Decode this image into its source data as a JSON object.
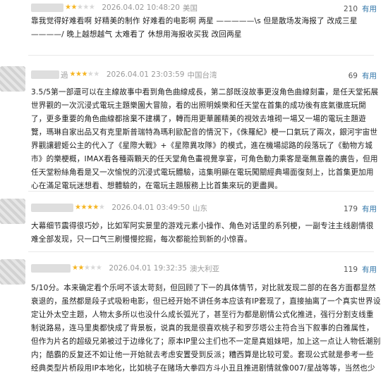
{
  "reviews": [
    {
      "rating": 2,
      "date": "2026.04.02 10:48:20",
      "location": "美国",
      "useful_count": "210",
      "useful_label": "有用",
      "lines": [
        "靠我觉得好难看啊 好精美的制作 好难看的电影啊 两星 —————\\s 但是散场发海报了 改成三星 ————/ 晚上越想越气 太难看了 休想用海报收买我 改回两星"
      ]
    },
    {
      "rating": 3,
      "user_suffix": "過",
      "date": "2026.04.01 23:03:59",
      "location": "中国台湾",
      "useful_count": "69",
      "useful_label": "有用",
      "lines": [
        "3.5/5第一部還可以在主線故事中看到角色曲線成長，第二部既沒故事更沒角色曲線刻畫，是任天堂拓展世界觀的一次沉浸式電玩主題樂園大冒險，看的出照明娛樂和任天堂在首集的成功後有底氣徹底玩開了，更多重要的角色曲線都捨棄不建構了，轉而用更華麗精美的視效去堆砌一場又一場的電玩主題遊覽，瑪琳自家出品又有克里斯普瑞特為瑪利歐配音的情況下，《侏羅紀》梗一口氣玩了兩次，銀河宇宙世界觀讓碧姬公主的代入了《星際大戰》+《星際異攻隊》的模式，進在機場認路的段落玩了《動物方城市》的樂梗概，IMAX看各種兩顆天的任天堂角色畫視覺享宴，可角色動力乘客是毫無意義的廣告，但用任天堂粉絲角看是又一次愉悅的沉浸式電玩體驗，這集明顯在電玩闖關經典場面復刻上，比首集更加用心在滿足電玩迷想看、想體驗的，在電玩主題服務上比首集來玩的更盡興。"
      ]
    },
    {
      "rating": 4,
      "date": "2026.04.01 03:49:50",
      "location": "山东",
      "useful_count": "179",
      "useful_label": "有用",
      "lines": [
        "大幕细节震得很巧妙，比如军阿实景里的游戏元素小操作、角色对话里的系列梗，一副专注主线剧情很难全部发现，只一口气三刷慢慢挖掘，每次都能捡到新的小惊喜。"
      ]
    },
    {
      "rating": 2,
      "date": "2026.04.01 19:32:35",
      "location": "澳大利亚",
      "useful_count": "119",
      "useful_label": "有用",
      "lines": [
        "5/10分。本来确定看个乐呵不该太苛刻，但回顾了下一的具体情节，对比就发现二部的在各方面都显然衰退的，虽然都是段子式吸粉电影，但已经开始不讲任务本应该有IP套现了，直接抽离了一个真实世界设定让外太空主题，人物太多所以也没什么成长弧光了，甚至行为都是剧情公式化推进，强行分割支线重制说路易，连马里奥都快成了背景板，说真的我是很喜欢桃子和罗莎塔公主符合当下叙事的白雅属性，但作为片名的超级兄弟被过于边缘化了；原本IP里公主们也不一定是真姐妹吧，加上这一点让人物低潮别内；酷霸的反复还不如让他一开始就去考虑安置受到反派；糟西算是比较可爱。套现公式就是参考一些经典类型片桥段用IP本地化，比如桃子在赌场大拳四方斗小丑且推进剧情就像007/星战等等，当然也少不了经典致敬桃子马里奥柔小酷霸机关，甚至直接用了像素版。"
      ]
    }
  ]
}
